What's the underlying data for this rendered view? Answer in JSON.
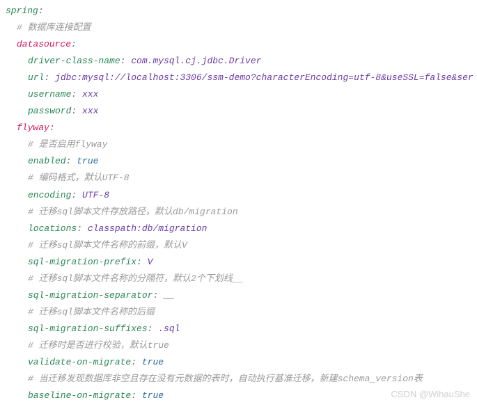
{
  "lines": [
    {
      "indent": 0,
      "type": "key",
      "key": "spring",
      "colon": ":"
    },
    {
      "indent": 1,
      "type": "comment",
      "text": "# 数据库连接配置"
    },
    {
      "indent": 1,
      "type": "key-em",
      "key": "datasource",
      "colon": ":"
    },
    {
      "indent": 2,
      "type": "kv",
      "key": "driver-class-name",
      "colon": ": ",
      "val": "com.mysql.cj.jdbc.Driver"
    },
    {
      "indent": 2,
      "type": "kv",
      "key": "url",
      "colon": ": ",
      "val": "jdbc:mysql://localhost:3306/ssm-demo?characterEncoding=utf-8&useSSL=false&ser"
    },
    {
      "indent": 2,
      "type": "kv",
      "key": "username",
      "colon": ": ",
      "val": "xxx"
    },
    {
      "indent": 2,
      "type": "kv",
      "key": "password",
      "colon": ": ",
      "val": "xxx"
    },
    {
      "indent": 1,
      "type": "key-em",
      "key": "flyway",
      "colon": ":"
    },
    {
      "indent": 2,
      "type": "comment",
      "text": "# 是否启用flyway"
    },
    {
      "indent": 2,
      "type": "kv-true",
      "key": "enabled",
      "colon": ": ",
      "val": "true"
    },
    {
      "indent": 2,
      "type": "comment",
      "text": "# 编码格式，默认UTF-8"
    },
    {
      "indent": 2,
      "type": "kv",
      "key": "encoding",
      "colon": ": ",
      "val": "UTF-8"
    },
    {
      "indent": 2,
      "type": "comment",
      "text": "# 迁移sql脚本文件存放路径，默认db/migration"
    },
    {
      "indent": 2,
      "type": "kv",
      "key": "locations",
      "colon": ": ",
      "val": "classpath:db/migration"
    },
    {
      "indent": 2,
      "type": "comment",
      "text": "# 迁移sql脚本文件名称的前缀，默认V"
    },
    {
      "indent": 2,
      "type": "kv",
      "key": "sql-migration-prefix",
      "colon": ": ",
      "val": "V"
    },
    {
      "indent": 2,
      "type": "comment",
      "text": "# 迁移sql脚本文件名称的分隔符，默认2个下划线__"
    },
    {
      "indent": 2,
      "type": "kv",
      "key": "sql-migration-separator",
      "colon": ": ",
      "val": "__"
    },
    {
      "indent": 2,
      "type": "comment",
      "text": "# 迁移sql脚本文件名称的后缀"
    },
    {
      "indent": 2,
      "type": "kv",
      "key": "sql-migration-suffixes",
      "colon": ": ",
      "val": ".sql"
    },
    {
      "indent": 2,
      "type": "comment",
      "text": "# 迁移时是否进行校验，默认true"
    },
    {
      "indent": 2,
      "type": "kv-true",
      "key": "validate-on-migrate",
      "colon": ": ",
      "val": "true"
    },
    {
      "indent": 2,
      "type": "comment",
      "text": "# 当迁移发现数据库非空且存在没有元数据的表时，自动执行基准迁移，新建schema_version表"
    },
    {
      "indent": 2,
      "type": "kv-true",
      "key": "baseline-on-migrate",
      "colon": ": ",
      "val": "true"
    }
  ],
  "watermark": "CSDN @WihauShe"
}
